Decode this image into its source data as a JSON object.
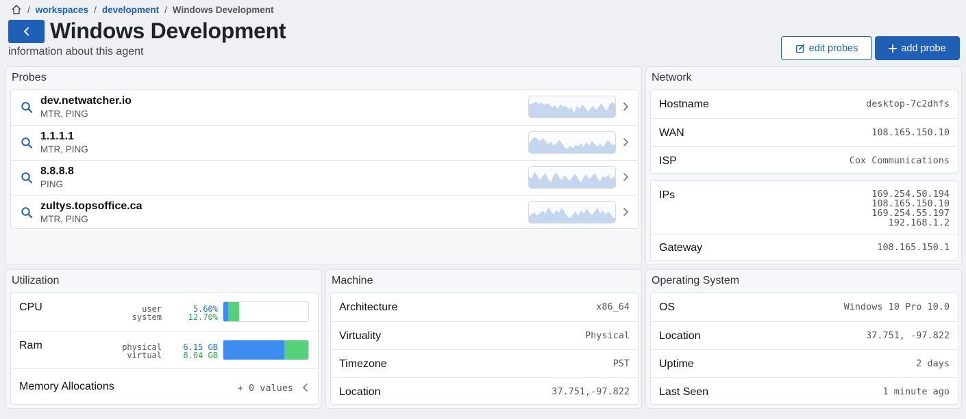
{
  "breadcrumb": {
    "items": [
      "workspaces",
      "development"
    ],
    "current": "Windows Development"
  },
  "header": {
    "title": "Windows Development",
    "subtitle": "information about this agent",
    "edit_label": "edit probes",
    "add_label": "add probe"
  },
  "probes": {
    "title": "Probes",
    "items": [
      {
        "name": "dev.netwatcher.io",
        "types": "MTR, PING"
      },
      {
        "name": "1.1.1.1",
        "types": "MTR, PING"
      },
      {
        "name": "8.8.8.8",
        "types": "PING"
      },
      {
        "name": "zultys.topsoffice.ca",
        "types": "MTR, PING"
      }
    ]
  },
  "network": {
    "title": "Network",
    "hostname_label": "Hostname",
    "hostname": "desktop-7c2dhfs",
    "wan_label": "WAN",
    "wan": "108.165.150.10",
    "isp_label": "ISP",
    "isp": "Cox Communications",
    "ips_label": "IPs",
    "ips": [
      "169.254.50.194",
      "108.165.150.10",
      "169.254.55.197",
      "192.168.1.2"
    ],
    "gateway_label": "Gateway",
    "gateway": "108.165.150.1"
  },
  "utilization": {
    "title": "Utilization",
    "cpu_label": "CPU",
    "cpu_user_label": "user",
    "cpu_system_label": "system",
    "cpu_user": "5.60%",
    "cpu_system": "12.70%",
    "cpu_user_frac": 0.056,
    "cpu_system_frac": 0.127,
    "ram_label": "Ram",
    "ram_physical_label": "physical",
    "ram_virtual_label": "virtual",
    "ram_physical": "6.15 GB",
    "ram_virtual": "8.04 GB",
    "ram_physical_frac": 0.715,
    "ram_virtual_frac": 0.285,
    "mem_label": "Memory Allocations",
    "mem_value": "+ 0 values"
  },
  "machine": {
    "title": "Machine",
    "arch_label": "Architecture",
    "arch": "x86_64",
    "virt_label": "Virtuality",
    "virt": "Physical",
    "tz_label": "Timezone",
    "tz": "PST",
    "loc_label": "Location",
    "loc": "37.751,-97.822"
  },
  "os": {
    "title": "Operating System",
    "os_label": "OS",
    "os": "Windows 10 Pro 10.0",
    "loc_label": "Location",
    "loc": "37.751, -97.822",
    "uptime_label": "Uptime",
    "uptime": "2 days",
    "seen_label": "Last Seen",
    "seen": "1 minute ago"
  },
  "colors": {
    "accent": "#1f5fb5",
    "cpu_user": "#3d8cf0",
    "cpu_system": "#57d07a"
  }
}
